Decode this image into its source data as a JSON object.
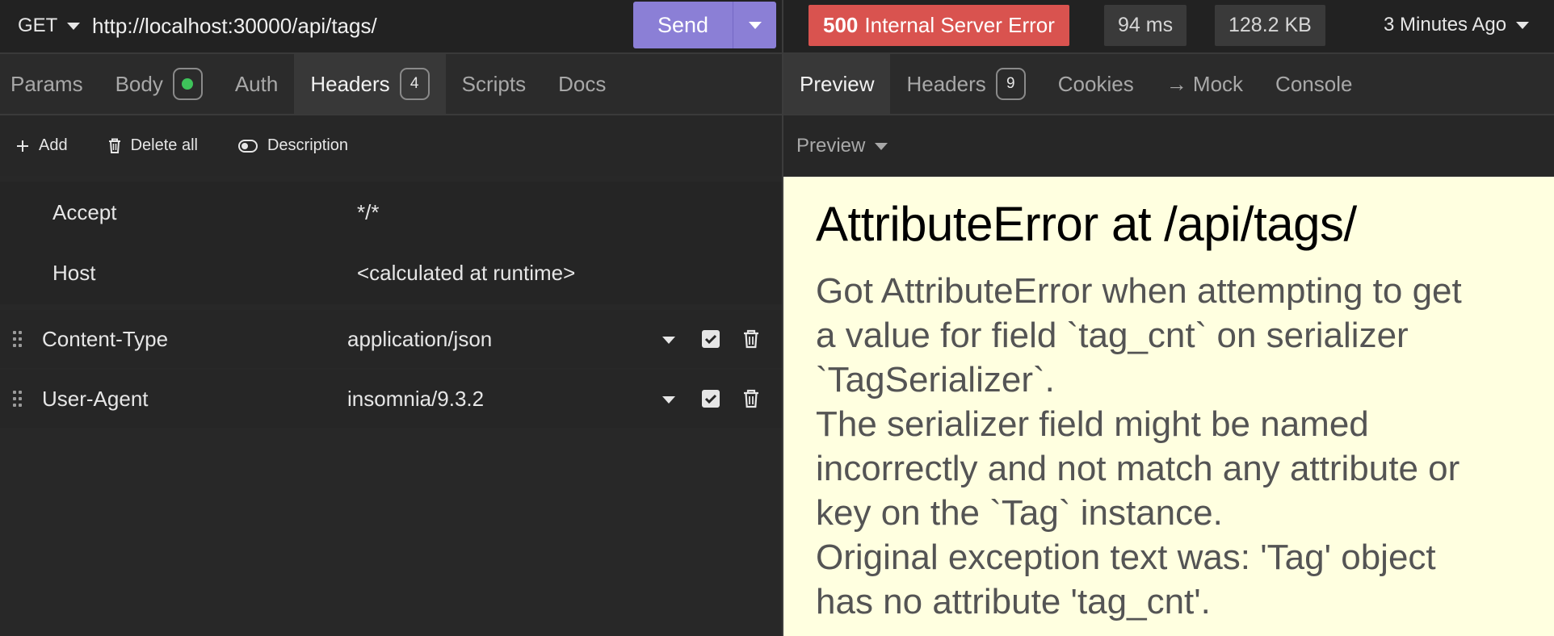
{
  "request": {
    "method": "GET",
    "url": "http://localhost:30000/api/tags/",
    "send_label": "Send"
  },
  "request_tabs": [
    {
      "label": "Params"
    },
    {
      "label": "Body"
    },
    {
      "label": "Auth"
    },
    {
      "label": "Headers",
      "badge": "4"
    },
    {
      "label": "Scripts"
    },
    {
      "label": "Docs"
    }
  ],
  "toolbar": {
    "add_label": "Add",
    "delete_all_label": "Delete all",
    "description_label": "Description"
  },
  "auto_headers": [
    {
      "name": "Accept",
      "value": "*/*"
    },
    {
      "name": "Host",
      "value": "<calculated at runtime>"
    }
  ],
  "headers": [
    {
      "name": "Content-Type",
      "value": "application/json",
      "enabled": true
    },
    {
      "name": "User-Agent",
      "value": "insomnia/9.3.2",
      "enabled": true
    }
  ],
  "response": {
    "status_code": "500",
    "status_text": "Internal Server Error",
    "time": "94 ms",
    "size": "128.2 KB",
    "ago": "3 Minutes Ago"
  },
  "response_tabs": [
    {
      "label": "Preview"
    },
    {
      "label": "Headers",
      "badge": "9"
    },
    {
      "label": "Cookies"
    },
    {
      "label": "→ Mock"
    },
    {
      "label": "Console"
    }
  ],
  "preview_mode": "Preview",
  "error": {
    "title": "AttributeError at /api/tags/",
    "lines": [
      "Got AttributeError when attempting to get",
      "a value for field `tag_cnt` on serializer",
      "`TagSerializer`.",
      "The serializer field might be named",
      "incorrectly and not match any attribute or",
      "key on the `Tag` instance.",
      "Original exception text was: 'Tag' object",
      "has no attribute 'tag_cnt'."
    ]
  },
  "colors": {
    "send": "#8b7fd6",
    "error_status": "#d9534f",
    "body_dot": "#3ec35a",
    "preview_bg": "#ffffe0"
  }
}
